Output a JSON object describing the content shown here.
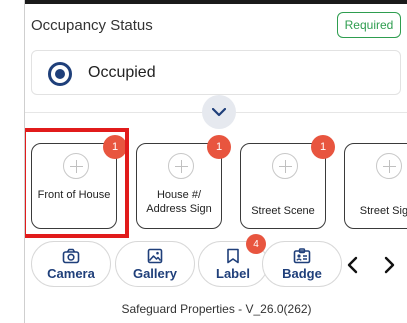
{
  "occupancy": {
    "title": "Occupancy Status",
    "required_label": "Required",
    "selected_option": "Occupied"
  },
  "photo_tiles": [
    {
      "label": "Front of House",
      "count": "1"
    },
    {
      "label": "House #/ Address Sign",
      "count": "1"
    },
    {
      "label": "Street Scene",
      "count": "1"
    },
    {
      "label": "Street Sign",
      "count": ""
    }
  ],
  "actions": {
    "camera": "Camera",
    "gallery": "Gallery",
    "label": "Label",
    "label_count": "4",
    "badge": "Badge"
  },
  "icons": {
    "expand": "chevron-down-icon",
    "camera": "camera-icon",
    "gallery": "image-icon",
    "label": "bookmark-icon",
    "badge": "id-badge-icon",
    "prev": "chevron-left-icon",
    "next": "chevron-right-icon"
  },
  "colors": {
    "accent": "#1f3f7a",
    "required": "#2e9d4f",
    "badge": "#e8553f",
    "highlight": "#e11b1b"
  },
  "footer": {
    "text": "Safeguard Properties - V_26.0(262)"
  }
}
